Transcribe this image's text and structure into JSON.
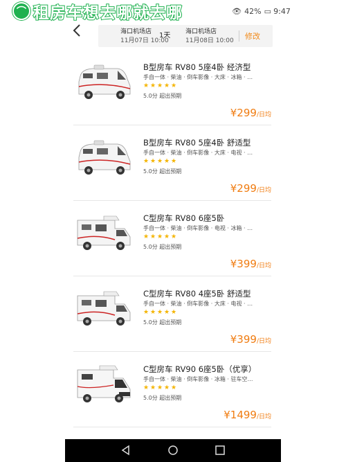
{
  "banner": {
    "text": "租房车想去哪就去哪"
  },
  "status": {
    "battery": "42%",
    "time": "9:47"
  },
  "header": {
    "pickup": {
      "name": "海口机场店",
      "date": "11月07日 10:00"
    },
    "days": "1天",
    "return": {
      "name": "海口机场店",
      "date": "11月08日 10:00"
    },
    "modify_label": "修改"
  },
  "vehicles": [
    {
      "title": "B型房车 RV80 5座4卧 经济型",
      "tags": "手自一体 · 柴油 · 倒车影像 · 大床 · 冰箱 · …",
      "rating": 5,
      "score": "5.0分",
      "note": "超出预期",
      "price": "¥299",
      "unit": "/日均",
      "image": "b-type-van"
    },
    {
      "title": "B型房车 RV80 5座4卧 舒适型",
      "tags": "手自一体 · 柴油 · 倒车影像 · 大床 · 电视 · …",
      "rating": 5,
      "score": "5.0分",
      "note": "超出预期",
      "price": "¥299",
      "unit": "/日均",
      "image": "b-type-van"
    },
    {
      "title": "C型房车 RV80 6座5卧",
      "tags": "手自一体 · 柴油 · 倒车影像 · 电视 · 冰箱 · …",
      "rating": 5,
      "score": "5.0分",
      "note": "超出预期",
      "price": "¥399",
      "unit": "/日均",
      "image": "c-type-rv"
    },
    {
      "title": "C型房车 RV80 4座5卧 舒适型",
      "tags": "手自一体 · 柴油 · 倒车影像 · 大床 · 电视 · …",
      "rating": 5,
      "score": "5.0分",
      "note": "超出预期",
      "price": "¥399",
      "unit": "/日均",
      "image": "c-type-rv"
    },
    {
      "title": "C型房车 RV90 6座5卧（优享）",
      "tags": "手自一体 · 柴油 · 倒车影像 · 冰箱 · 驻车空…",
      "rating": 5,
      "score": "5.0分",
      "note": "超出预期",
      "price": "¥1499",
      "unit": "/日均",
      "image": "c-type-rv-modern"
    }
  ],
  "colors": {
    "accent": "#f07c11",
    "star": "#f4b400",
    "banner_green": "#1fb14f"
  }
}
